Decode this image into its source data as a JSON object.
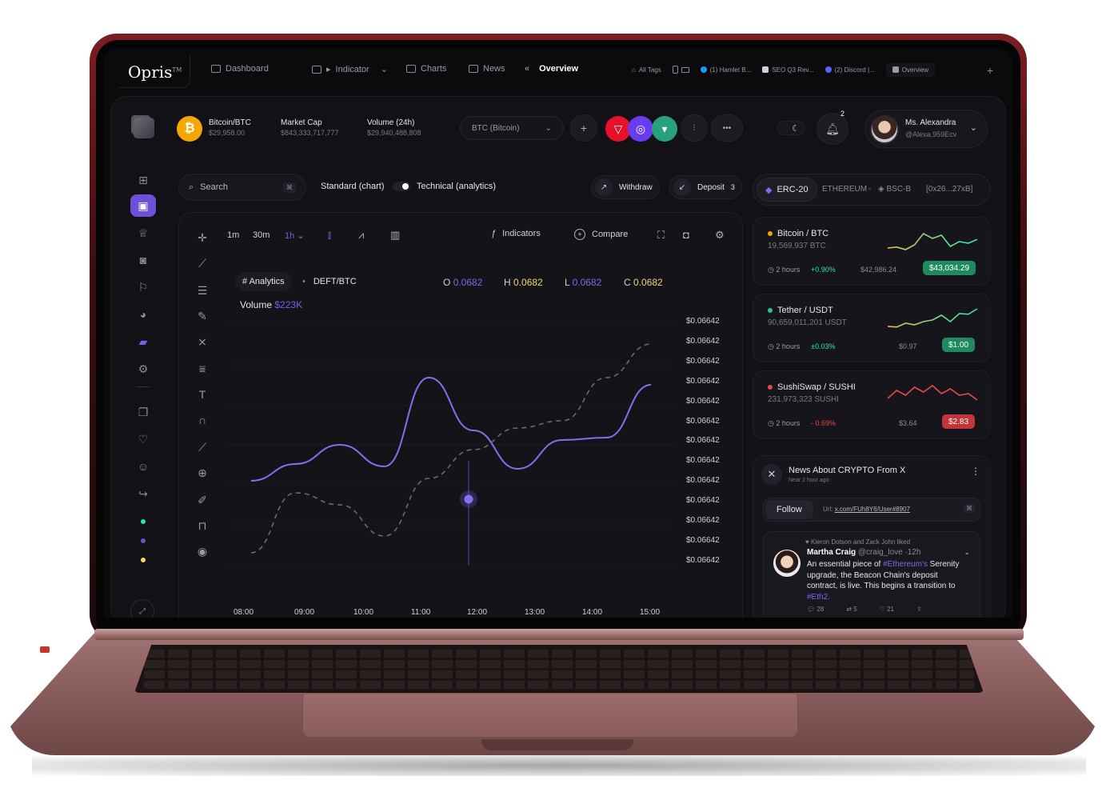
{
  "app": {
    "logo": "Opris",
    "logo_mark": "TM"
  },
  "topnav": {
    "dashboard": "Dashboard",
    "indicator": "Indicator",
    "charts": "Charts",
    "news": "News",
    "overview": "Overview"
  },
  "browser_tabs": [
    {
      "label": "All Tags"
    },
    {
      "label": "(1) Hamlet B..."
    },
    {
      "label": "SEO Q3 Rev..."
    },
    {
      "label": "(2) Discord |..."
    },
    {
      "label": "Overview"
    }
  ],
  "header": {
    "coin_symbol": "₿",
    "coin_pair": "Bitcoin/BTC",
    "coin_price": "$29,958.00",
    "market_cap_label": "Market Cap",
    "market_cap_value": "$843,333,717,777",
    "volume_label": "Volume (24h)",
    "volume_value": "$29,940,488,808",
    "coin_select": "BTC (Bitcoin)",
    "notifications_count": "2",
    "user_name": "Ms. Alexandra",
    "user_handle": "@Alexa.959Ecv"
  },
  "toolbar": {
    "search_label": "Search",
    "search_kbd": "⌘",
    "mode_standard": "Standard (chart)",
    "mode_technical": "Technical (analytics)",
    "withdraw": "Withdraw",
    "deposit": "Deposit",
    "deposit_count": "3"
  },
  "chart": {
    "timeframes": [
      "1m",
      "30m",
      "1h"
    ],
    "indicators": "Indicators",
    "compare": "Compare",
    "analytics_tag": "# Analytics",
    "pair": "DEFT/BTC",
    "o_label": "O",
    "o_value": "0.0682",
    "h_label": "H",
    "h_value": "0.0682",
    "l_label": "L",
    "l_value": "0.0682",
    "c_label": "C",
    "c_value": "0.0682",
    "volume_label": "Volume",
    "volume_value": "$223K"
  },
  "chart_data": {
    "type": "line",
    "x": [
      "08:00",
      "09:00",
      "10:00",
      "11:00",
      "12:00",
      "13:00",
      "14:00",
      "15:00"
    ],
    "y_tick_labels": [
      "$0.06642",
      "$0.06642",
      "$0.06642",
      "$0.06642",
      "$0.06642",
      "$0.06642",
      "$0.06642",
      "$0.06642",
      "$0.06642",
      "$0.06642",
      "$0.06642",
      "$0.06642",
      "$0.06642"
    ],
    "series": [
      {
        "style": "solid",
        "color": "#8a6cf0",
        "values": [
          0.35,
          0.42,
          0.5,
          0.41,
          0.78,
          0.56,
          0.4,
          0.52,
          0.53,
          0.75
        ]
      },
      {
        "style": "dashed",
        "color": "#6a6a74",
        "values": [
          0.05,
          0.3,
          0.25,
          0.12,
          0.36,
          0.48,
          0.57,
          0.6,
          0.78,
          0.92
        ]
      }
    ],
    "grid": true
  },
  "networks": {
    "active": "ERC-20",
    "ethereum": "ETHEREUM",
    "bsc": "BSC-B",
    "address": "[0x26...27xB]"
  },
  "coins": [
    {
      "name": "Bitcoin / BTC",
      "amount": "19,569,937 BTC",
      "time": "2 hours",
      "change": "+0.90%",
      "prev": "$42,986.24",
      "price": "$43,034.29",
      "dot": "#f7a600",
      "up": true
    },
    {
      "name": "Tether / USDT",
      "amount": "90,659,011,201 USDT",
      "time": "2 hours",
      "change": "±0.03%",
      "prev": "$0.97",
      "price": "$1.00",
      "dot": "#2ec28a",
      "up": true
    },
    {
      "name": "SushiSwap / SUSHI",
      "amount": "231,973,323 SUSHI",
      "time": "2 hours",
      "change": "- 0.69%",
      "prev": "$3.64",
      "price": "$2.83",
      "dot": "#e84848",
      "up": false
    }
  ],
  "news": {
    "title": "News About CRYPTO From X",
    "subtitle": "Near 2 hour ago",
    "follow": "Follow",
    "url_label": "Url:",
    "url_value": "x.com/FUh8Y6/User#8907",
    "url_kbd": "⌘",
    "liked_by": "Kieron Dotson and Zack John liked",
    "author": "Martha Craig",
    "handle": "@craig_love ·12h",
    "body_1": "An essential piece of",
    "tag_1": "#Ethereum's",
    "body_2": "Serenity upgrade, the Beacon Chain's deposit contract, is live. This begins a transition to",
    "tag_2": "#Eth2.",
    "comments": "28",
    "retweets": "5",
    "likes": "21"
  }
}
